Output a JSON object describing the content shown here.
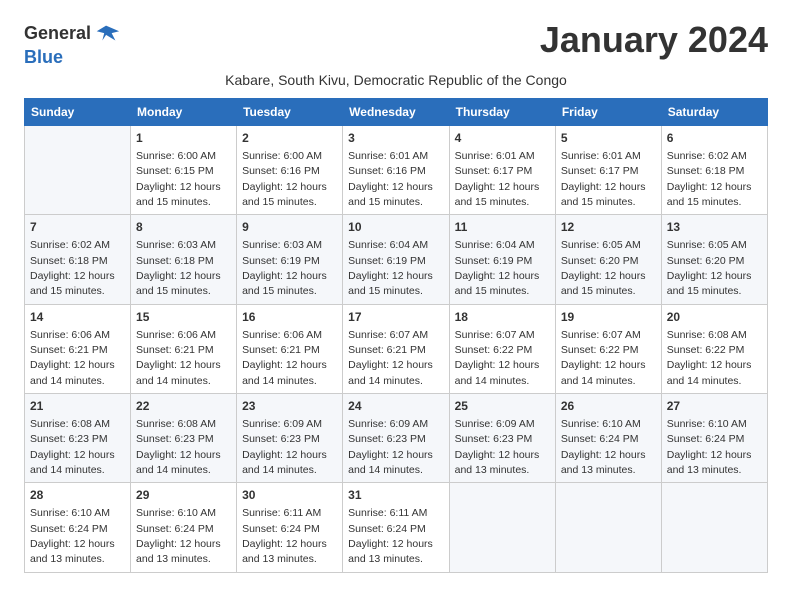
{
  "header": {
    "logo_general": "General",
    "logo_blue": "Blue",
    "month_title": "January 2024",
    "subtitle": "Kabare, South Kivu, Democratic Republic of the Congo"
  },
  "days_of_week": [
    "Sunday",
    "Monday",
    "Tuesday",
    "Wednesday",
    "Thursday",
    "Friday",
    "Saturday"
  ],
  "weeks": [
    [
      {
        "day": "",
        "info": ""
      },
      {
        "day": "1",
        "info": "Sunrise: 6:00 AM\nSunset: 6:15 PM\nDaylight: 12 hours\nand 15 minutes."
      },
      {
        "day": "2",
        "info": "Sunrise: 6:00 AM\nSunset: 6:16 PM\nDaylight: 12 hours\nand 15 minutes."
      },
      {
        "day": "3",
        "info": "Sunrise: 6:01 AM\nSunset: 6:16 PM\nDaylight: 12 hours\nand 15 minutes."
      },
      {
        "day": "4",
        "info": "Sunrise: 6:01 AM\nSunset: 6:17 PM\nDaylight: 12 hours\nand 15 minutes."
      },
      {
        "day": "5",
        "info": "Sunrise: 6:01 AM\nSunset: 6:17 PM\nDaylight: 12 hours\nand 15 minutes."
      },
      {
        "day": "6",
        "info": "Sunrise: 6:02 AM\nSunset: 6:18 PM\nDaylight: 12 hours\nand 15 minutes."
      }
    ],
    [
      {
        "day": "7",
        "info": "Sunrise: 6:02 AM\nSunset: 6:18 PM\nDaylight: 12 hours\nand 15 minutes."
      },
      {
        "day": "8",
        "info": "Sunrise: 6:03 AM\nSunset: 6:18 PM\nDaylight: 12 hours\nand 15 minutes."
      },
      {
        "day": "9",
        "info": "Sunrise: 6:03 AM\nSunset: 6:19 PM\nDaylight: 12 hours\nand 15 minutes."
      },
      {
        "day": "10",
        "info": "Sunrise: 6:04 AM\nSunset: 6:19 PM\nDaylight: 12 hours\nand 15 minutes."
      },
      {
        "day": "11",
        "info": "Sunrise: 6:04 AM\nSunset: 6:19 PM\nDaylight: 12 hours\nand 15 minutes."
      },
      {
        "day": "12",
        "info": "Sunrise: 6:05 AM\nSunset: 6:20 PM\nDaylight: 12 hours\nand 15 minutes."
      },
      {
        "day": "13",
        "info": "Sunrise: 6:05 AM\nSunset: 6:20 PM\nDaylight: 12 hours\nand 15 minutes."
      }
    ],
    [
      {
        "day": "14",
        "info": "Sunrise: 6:06 AM\nSunset: 6:21 PM\nDaylight: 12 hours\nand 14 minutes."
      },
      {
        "day": "15",
        "info": "Sunrise: 6:06 AM\nSunset: 6:21 PM\nDaylight: 12 hours\nand 14 minutes."
      },
      {
        "day": "16",
        "info": "Sunrise: 6:06 AM\nSunset: 6:21 PM\nDaylight: 12 hours\nand 14 minutes."
      },
      {
        "day": "17",
        "info": "Sunrise: 6:07 AM\nSunset: 6:21 PM\nDaylight: 12 hours\nand 14 minutes."
      },
      {
        "day": "18",
        "info": "Sunrise: 6:07 AM\nSunset: 6:22 PM\nDaylight: 12 hours\nand 14 minutes."
      },
      {
        "day": "19",
        "info": "Sunrise: 6:07 AM\nSunset: 6:22 PM\nDaylight: 12 hours\nand 14 minutes."
      },
      {
        "day": "20",
        "info": "Sunrise: 6:08 AM\nSunset: 6:22 PM\nDaylight: 12 hours\nand 14 minutes."
      }
    ],
    [
      {
        "day": "21",
        "info": "Sunrise: 6:08 AM\nSunset: 6:23 PM\nDaylight: 12 hours\nand 14 minutes."
      },
      {
        "day": "22",
        "info": "Sunrise: 6:08 AM\nSunset: 6:23 PM\nDaylight: 12 hours\nand 14 minutes."
      },
      {
        "day": "23",
        "info": "Sunrise: 6:09 AM\nSunset: 6:23 PM\nDaylight: 12 hours\nand 14 minutes."
      },
      {
        "day": "24",
        "info": "Sunrise: 6:09 AM\nSunset: 6:23 PM\nDaylight: 12 hours\nand 14 minutes."
      },
      {
        "day": "25",
        "info": "Sunrise: 6:09 AM\nSunset: 6:23 PM\nDaylight: 12 hours\nand 13 minutes."
      },
      {
        "day": "26",
        "info": "Sunrise: 6:10 AM\nSunset: 6:24 PM\nDaylight: 12 hours\nand 13 minutes."
      },
      {
        "day": "27",
        "info": "Sunrise: 6:10 AM\nSunset: 6:24 PM\nDaylight: 12 hours\nand 13 minutes."
      }
    ],
    [
      {
        "day": "28",
        "info": "Sunrise: 6:10 AM\nSunset: 6:24 PM\nDaylight: 12 hours\nand 13 minutes."
      },
      {
        "day": "29",
        "info": "Sunrise: 6:10 AM\nSunset: 6:24 PM\nDaylight: 12 hours\nand 13 minutes."
      },
      {
        "day": "30",
        "info": "Sunrise: 6:11 AM\nSunset: 6:24 PM\nDaylight: 12 hours\nand 13 minutes."
      },
      {
        "day": "31",
        "info": "Sunrise: 6:11 AM\nSunset: 6:24 PM\nDaylight: 12 hours\nand 13 minutes."
      },
      {
        "day": "",
        "info": ""
      },
      {
        "day": "",
        "info": ""
      },
      {
        "day": "",
        "info": ""
      }
    ]
  ]
}
